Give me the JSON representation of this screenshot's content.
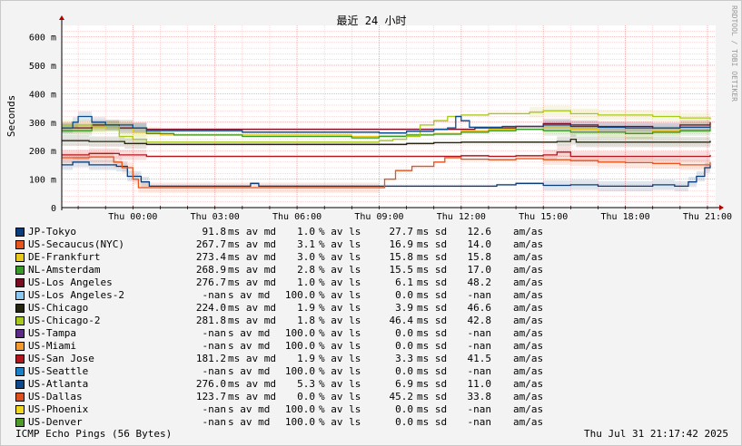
{
  "chart_data": {
    "type": "line",
    "title": "最近 24 小时",
    "ylabel": "Seconds",
    "watermark": "RRDTOOL / TOBI OETIKER",
    "y_ticks": [
      "0",
      "100 m",
      "200 m",
      "300 m",
      "400 m",
      "500 m",
      "600 m"
    ],
    "y_tick_values": [
      0,
      100,
      200,
      300,
      400,
      500,
      600
    ],
    "ylim": [
      0,
      640
    ],
    "x_ticks": [
      "Thu 00:00",
      "Thu 03:00",
      "Thu 06:00",
      "Thu 09:00",
      "Thu 12:00",
      "Thu 15:00",
      "Thu 18:00",
      "Thu 21:00"
    ],
    "x_tick_hours": [
      0,
      3,
      6,
      9,
      12,
      15,
      18,
      21
    ],
    "xlim": [
      -2.6,
      21.3
    ],
    "grid": true,
    "series": [
      {
        "name": "JP-Tokyo",
        "color": "#0b3d7a",
        "points": [
          [
            -2.6,
            150
          ],
          [
            -2.2,
            160
          ],
          [
            -1.6,
            150
          ],
          [
            -0.6,
            145
          ],
          [
            -0.2,
            110
          ],
          [
            0.3,
            90
          ],
          [
            0.6,
            75
          ],
          [
            4.0,
            75
          ],
          [
            4.3,
            85
          ],
          [
            4.6,
            75
          ],
          [
            11.3,
            75
          ],
          [
            12.5,
            75
          ],
          [
            13.3,
            80
          ],
          [
            14.0,
            85
          ],
          [
            15.0,
            78
          ],
          [
            16.0,
            80
          ],
          [
            17.0,
            75
          ],
          [
            18.0,
            75
          ],
          [
            19.0,
            80
          ],
          [
            19.8,
            75
          ],
          [
            20.3,
            90
          ],
          [
            20.6,
            110
          ],
          [
            20.9,
            140
          ],
          [
            21.1,
            150
          ]
        ]
      },
      {
        "name": "US-Secaucus(NYC)",
        "color": "#e8541b",
        "points": [
          [
            -2.6,
            175
          ],
          [
            -1.6,
            178
          ],
          [
            -0.7,
            160
          ],
          [
            -0.4,
            140
          ],
          [
            0.0,
            100
          ],
          [
            0.2,
            70
          ],
          [
            9.0,
            70
          ],
          [
            9.2,
            100
          ],
          [
            9.6,
            130
          ],
          [
            10.2,
            145
          ],
          [
            11.0,
            160
          ],
          [
            11.4,
            175
          ],
          [
            12.0,
            170
          ],
          [
            13.0,
            168
          ],
          [
            14.0,
            172
          ],
          [
            15.0,
            168
          ],
          [
            16.0,
            165
          ],
          [
            17.0,
            160
          ],
          [
            18.0,
            158
          ],
          [
            19.0,
            155
          ],
          [
            20.0,
            150
          ],
          [
            21.1,
            160
          ]
        ]
      },
      {
        "name": "DE-Frankfurt",
        "color": "#eac81b",
        "points": [
          [
            -2.6,
            280
          ],
          [
            -1.0,
            290
          ],
          [
            0.0,
            265
          ],
          [
            1.0,
            255
          ],
          [
            3.0,
            255
          ],
          [
            8.0,
            250
          ],
          [
            9.0,
            252
          ],
          [
            10.0,
            255
          ],
          [
            11.0,
            260
          ],
          [
            12.0,
            270
          ],
          [
            13.0,
            275
          ],
          [
            14.0,
            275
          ],
          [
            15.0,
            280
          ],
          [
            16.0,
            275
          ],
          [
            17.0,
            265
          ],
          [
            18.0,
            260
          ],
          [
            19.0,
            270
          ],
          [
            20.0,
            280
          ],
          [
            21.1,
            300
          ]
        ]
      },
      {
        "name": "NL-Amsterdam",
        "color": "#3a9a28",
        "points": [
          [
            -2.6,
            270
          ],
          [
            -1.5,
            285
          ],
          [
            -0.5,
            280
          ],
          [
            0.5,
            260
          ],
          [
            1.5,
            255
          ],
          [
            4.0,
            250
          ],
          [
            8.0,
            245
          ],
          [
            9.0,
            250
          ],
          [
            10.0,
            255
          ],
          [
            11.0,
            258
          ],
          [
            12.0,
            265
          ],
          [
            13.0,
            270
          ],
          [
            14.0,
            275
          ],
          [
            15.0,
            270
          ],
          [
            16.0,
            265
          ],
          [
            17.0,
            265
          ],
          [
            18.0,
            260
          ],
          [
            19.0,
            265
          ],
          [
            20.0,
            270
          ],
          [
            21.1,
            280
          ]
        ]
      },
      {
        "name": "US-Los Angeles",
        "color": "#7a0b22",
        "points": [
          [
            -2.6,
            280
          ],
          [
            -1.5,
            290
          ],
          [
            -0.5,
            280
          ],
          [
            0.5,
            275
          ],
          [
            4.0,
            275
          ],
          [
            11.5,
            275
          ],
          [
            12.5,
            280
          ],
          [
            14.0,
            285
          ],
          [
            15.0,
            295
          ],
          [
            16.0,
            290
          ],
          [
            17.0,
            285
          ],
          [
            18.0,
            285
          ],
          [
            19.0,
            280
          ],
          [
            20.0,
            290
          ],
          [
            21.1,
            300
          ]
        ]
      },
      {
        "name": "US-Los Angeles-2",
        "color": "#8cc7ef",
        "points": []
      },
      {
        "name": "US-Chicago",
        "color": "#262610",
        "points": [
          [
            -2.6,
            235
          ],
          [
            -1.6,
            232
          ],
          [
            -0.3,
            225
          ],
          [
            0.5,
            222
          ],
          [
            9.0,
            222
          ],
          [
            10.0,
            225
          ],
          [
            11.0,
            228
          ],
          [
            12.0,
            230
          ],
          [
            14.0,
            230
          ],
          [
            15.5,
            232
          ],
          [
            16.0,
            240
          ],
          [
            16.2,
            230
          ],
          [
            18.0,
            230
          ],
          [
            20.0,
            230
          ],
          [
            21.1,
            235
          ]
        ]
      },
      {
        "name": "US-Chicago-2",
        "color": "#a8c81b",
        "points": [
          [
            -2.6,
            290
          ],
          [
            -1.5,
            285
          ],
          [
            -0.5,
            250
          ],
          [
            0.0,
            240
          ],
          [
            0.5,
            230
          ],
          [
            8.0,
            230
          ],
          [
            9.0,
            235
          ],
          [
            9.5,
            240
          ],
          [
            10.0,
            250
          ],
          [
            10.5,
            290
          ],
          [
            11.0,
            305
          ],
          [
            11.5,
            320
          ],
          [
            12.0,
            325
          ],
          [
            13.0,
            330
          ],
          [
            14.0,
            330
          ],
          [
            14.5,
            335
          ],
          [
            15.0,
            340
          ],
          [
            16.0,
            330
          ],
          [
            17.0,
            325
          ],
          [
            18.0,
            325
          ],
          [
            19.0,
            320
          ],
          [
            20.0,
            315
          ],
          [
            21.1,
            310
          ]
        ]
      },
      {
        "name": "US-Tampa",
        "color": "#5e2a8a",
        "points": []
      },
      {
        "name": "US-Miami",
        "color": "#f29a2e",
        "points": []
      },
      {
        "name": "US-San Jose",
        "color": "#b3161c",
        "points": [
          [
            -2.6,
            185
          ],
          [
            -1.6,
            190
          ],
          [
            -0.5,
            185
          ],
          [
            0.5,
            180
          ],
          [
            11.0,
            180
          ],
          [
            12.0,
            182
          ],
          [
            13.0,
            180
          ],
          [
            14.0,
            182
          ],
          [
            15.0,
            185
          ],
          [
            15.5,
            195
          ],
          [
            16.0,
            180
          ],
          [
            18.0,
            180
          ],
          [
            20.0,
            180
          ],
          [
            21.1,
            185
          ]
        ]
      },
      {
        "name": "US-Seattle",
        "color": "#1b80c8",
        "points": []
      },
      {
        "name": "US-Atlanta",
        "color": "#0d4a8a",
        "points": [
          [
            -2.6,
            280
          ],
          [
            -2.2,
            300
          ],
          [
            -2.0,
            320
          ],
          [
            -1.5,
            300
          ],
          [
            -1.0,
            290
          ],
          [
            0.0,
            280
          ],
          [
            0.5,
            270
          ],
          [
            4.0,
            265
          ],
          [
            9.0,
            262
          ],
          [
            10.0,
            268
          ],
          [
            11.0,
            275
          ],
          [
            11.5,
            280
          ],
          [
            11.8,
            320
          ],
          [
            12.0,
            305
          ],
          [
            12.3,
            282
          ],
          [
            13.5,
            285
          ],
          [
            15.0,
            290
          ],
          [
            16.0,
            285
          ],
          [
            17.0,
            282
          ],
          [
            18.0,
            280
          ],
          [
            20.0,
            282
          ],
          [
            21.1,
            288
          ]
        ]
      },
      {
        "name": "US-Dallas",
        "color": "#e04f1b",
        "points": []
      },
      {
        "name": "US-Phoenix",
        "color": "#f1d61e",
        "points": []
      },
      {
        "name": "US-Denver",
        "color": "#4e9a28",
        "points": []
      }
    ],
    "legend_rows": [
      {
        "name": "JP-Tokyo",
        "color": "#0b3d7a",
        "avg": "91.8",
        "avg_unit": "ms av md",
        "loss": "1.0",
        "loss_unit": "% av ls",
        "latency_sd": "27.7",
        "lsd_unit": "ms sd",
        "am": "12.6",
        "am_unit": "am/as"
      },
      {
        "name": "US-Secaucus(NYC)",
        "color": "#e8541b",
        "avg": "267.7",
        "avg_unit": "ms av md",
        "loss": "3.1",
        "loss_unit": "% av ls",
        "latency_sd": "16.9",
        "lsd_unit": "ms sd",
        "am": "14.0",
        "am_unit": "am/as"
      },
      {
        "name": "DE-Frankfurt",
        "color": "#eac81b",
        "avg": "273.4",
        "avg_unit": "ms av md",
        "loss": "3.0",
        "loss_unit": "% av ls",
        "latency_sd": "15.8",
        "lsd_unit": "ms sd",
        "am": "15.8",
        "am_unit": "am/as"
      },
      {
        "name": "NL-Amsterdam",
        "color": "#3a9a28",
        "avg": "268.9",
        "avg_unit": "ms av md",
        "loss": "2.8",
        "loss_unit": "% av ls",
        "latency_sd": "15.5",
        "lsd_unit": "ms sd",
        "am": "17.0",
        "am_unit": "am/as"
      },
      {
        "name": "US-Los Angeles",
        "color": "#7a0b22",
        "avg": "276.7",
        "avg_unit": "ms av md",
        "loss": "1.0",
        "loss_unit": "% av ls",
        "latency_sd": "6.1",
        "lsd_unit": "ms sd",
        "am": "48.2",
        "am_unit": "am/as"
      },
      {
        "name": "US-Los Angeles-2",
        "color": "#8cc7ef",
        "avg": "-nan",
        "avg_unit": "s av md",
        "loss": "100.0",
        "loss_unit": "% av ls",
        "latency_sd": "0.0",
        "lsd_unit": "ms sd",
        "am": "-nan",
        "am_unit": "am/as"
      },
      {
        "name": "US-Chicago",
        "color": "#262610",
        "avg": "224.0",
        "avg_unit": "ms av md",
        "loss": "1.9",
        "loss_unit": "% av ls",
        "latency_sd": "3.9",
        "lsd_unit": "ms sd",
        "am": "46.6",
        "am_unit": "am/as"
      },
      {
        "name": "US-Chicago-2",
        "color": "#a8c81b",
        "avg": "281.8",
        "avg_unit": "ms av md",
        "loss": "1.8",
        "loss_unit": "% av ls",
        "latency_sd": "46.4",
        "lsd_unit": "ms sd",
        "am": "42.8",
        "am_unit": "am/as"
      },
      {
        "name": "US-Tampa",
        "color": "#5e2a8a",
        "avg": "-nan",
        "avg_unit": "s av md",
        "loss": "100.0",
        "loss_unit": "% av ls",
        "latency_sd": "0.0",
        "lsd_unit": "ms sd",
        "am": "-nan",
        "am_unit": "am/as"
      },
      {
        "name": "US-Miami",
        "color": "#f29a2e",
        "avg": "-nan",
        "avg_unit": "s av md",
        "loss": "100.0",
        "loss_unit": "% av ls",
        "latency_sd": "0.0",
        "lsd_unit": "ms sd",
        "am": "-nan",
        "am_unit": "am/as"
      },
      {
        "name": "US-San Jose",
        "color": "#b3161c",
        "avg": "181.2",
        "avg_unit": "ms av md",
        "loss": "1.9",
        "loss_unit": "% av ls",
        "latency_sd": "3.3",
        "lsd_unit": "ms sd",
        "am": "41.5",
        "am_unit": "am/as"
      },
      {
        "name": "US-Seattle",
        "color": "#1b80c8",
        "avg": "-nan",
        "avg_unit": "s av md",
        "loss": "100.0",
        "loss_unit": "% av ls",
        "latency_sd": "0.0",
        "lsd_unit": "ms sd",
        "am": "-nan",
        "am_unit": "am/as"
      },
      {
        "name": "US-Atlanta",
        "color": "#0d4a8a",
        "avg": "276.0",
        "avg_unit": "ms av md",
        "loss": "5.3",
        "loss_unit": "% av ls",
        "latency_sd": "6.9",
        "lsd_unit": "ms sd",
        "am": "11.0",
        "am_unit": "am/as"
      },
      {
        "name": "US-Dallas",
        "color": "#e04f1b",
        "avg": "123.7",
        "avg_unit": "ms av md",
        "loss": "0.0",
        "loss_unit": "% av ls",
        "latency_sd": "45.2",
        "lsd_unit": "ms sd",
        "am": "33.8",
        "am_unit": "am/as"
      },
      {
        "name": "US-Phoenix",
        "color": "#f1d61e",
        "avg": "-nan",
        "avg_unit": "s av md",
        "loss": "100.0",
        "loss_unit": "% av ls",
        "latency_sd": "0.0",
        "lsd_unit": "ms sd",
        "am": "-nan",
        "am_unit": "am/as"
      },
      {
        "name": "US-Denver",
        "color": "#4e9a28",
        "avg": "-nan",
        "avg_unit": "s av md",
        "loss": "100.0",
        "loss_unit": "% av ls",
        "latency_sd": "0.0",
        "lsd_unit": "ms sd",
        "am": "-nan",
        "am_unit": "am/as"
      }
    ]
  },
  "footer": {
    "probe": "ICMP Echo Pings (56 Bytes)",
    "timestamp": "Thu Jul 31 21:17:42 2025"
  }
}
